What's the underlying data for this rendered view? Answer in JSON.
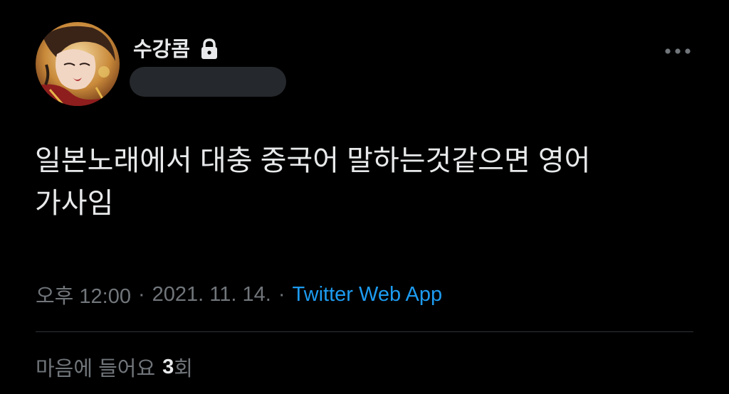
{
  "author": {
    "display_name": "수강콤",
    "avatar_icon": "avatar-image",
    "protected_icon": "lock-icon",
    "handle_redacted": true
  },
  "header": {
    "more_icon": "more-horizontal-icon"
  },
  "tweet": {
    "text": "일본노래에서 대충 중국어 말하는것같으면 영어\n가사임"
  },
  "meta": {
    "time": "오후 12:00",
    "separator": "·",
    "date": "2021. 11. 14.",
    "source": "Twitter Web App"
  },
  "stats": {
    "likes_label": "마음에 들어요",
    "likes_count": "3",
    "likes_suffix": "회"
  },
  "colors": {
    "background": "#000000",
    "primary_text": "#e7e9ea",
    "secondary_text": "#71767b",
    "link": "#1d9bf0",
    "divider": "#2f3336",
    "redaction": "#25282c"
  }
}
